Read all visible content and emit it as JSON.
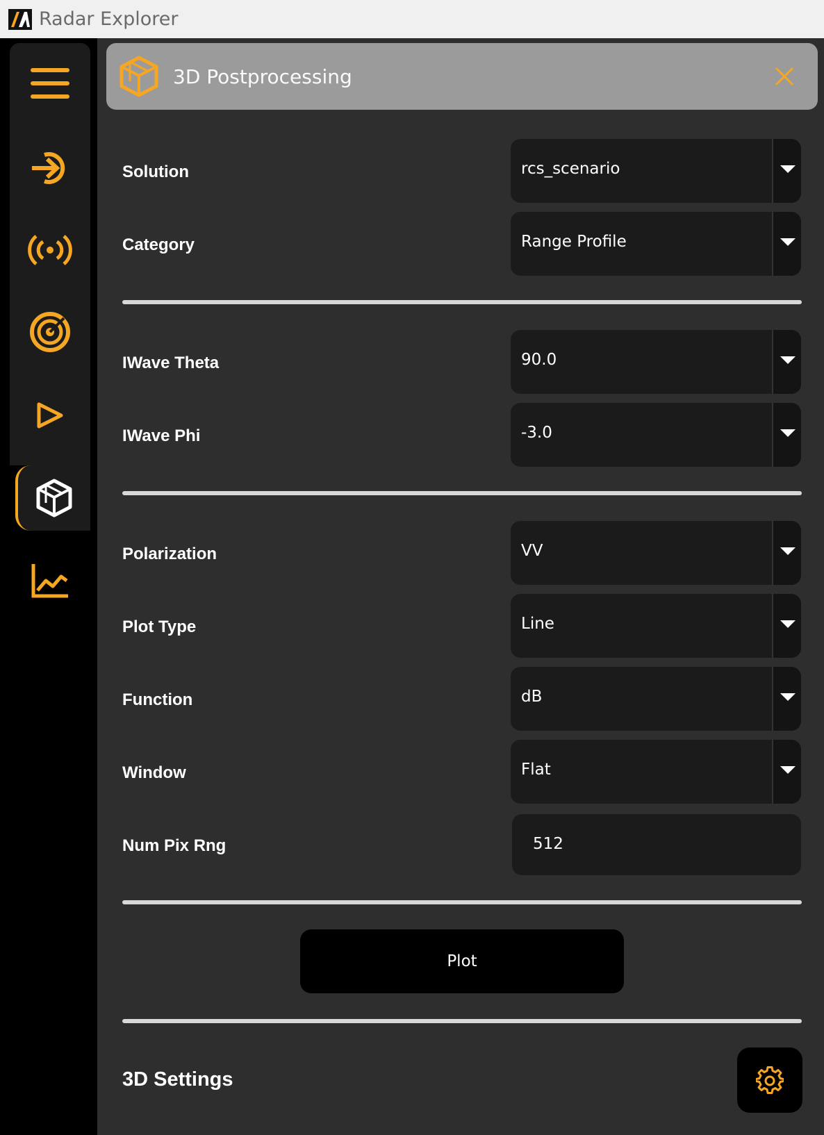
{
  "window": {
    "title": "Radar Explorer"
  },
  "colors": {
    "accent": "#f5a623",
    "panel_bg": "#2e2e2e",
    "field_bg": "#1b1b1b",
    "header_bg": "#9b9b9b"
  },
  "sidebar": {
    "items": [
      {
        "name": "menu",
        "icon": "hamburger-menu-icon"
      },
      {
        "name": "import",
        "icon": "import-arrow-icon"
      },
      {
        "name": "antenna",
        "icon": "broadcast-icon"
      },
      {
        "name": "radar",
        "icon": "radar-target-icon"
      },
      {
        "name": "run",
        "icon": "play-triangle-icon"
      },
      {
        "name": "3d-postprocessing",
        "icon": "cube-icon",
        "active": true
      },
      {
        "name": "2d-postprocessing",
        "icon": "chart-line-icon"
      }
    ]
  },
  "panel": {
    "title": "3D Postprocessing",
    "icon": "cube-icon",
    "close_icon": "close-icon"
  },
  "form": {
    "solution": {
      "label": "Solution",
      "value": "rcs_scenario"
    },
    "category": {
      "label": "Category",
      "value": "Range Profile"
    },
    "iwave_theta": {
      "label": "IWave Theta",
      "value": "90.0"
    },
    "iwave_phi": {
      "label": "IWave Phi",
      "value": "-3.0"
    },
    "polarization": {
      "label": "Polarization",
      "value": "VV"
    },
    "plot_type": {
      "label": "Plot Type",
      "value": "Line"
    },
    "function": {
      "label": "Function",
      "value": "dB"
    },
    "window": {
      "label": "Window",
      "value": "Flat"
    },
    "num_pix_rng": {
      "label": "Num Pix Rng",
      "value": "512"
    }
  },
  "plot_button": {
    "label": "Plot"
  },
  "settings": {
    "title": "3D Settings",
    "icon": "gear-icon"
  }
}
